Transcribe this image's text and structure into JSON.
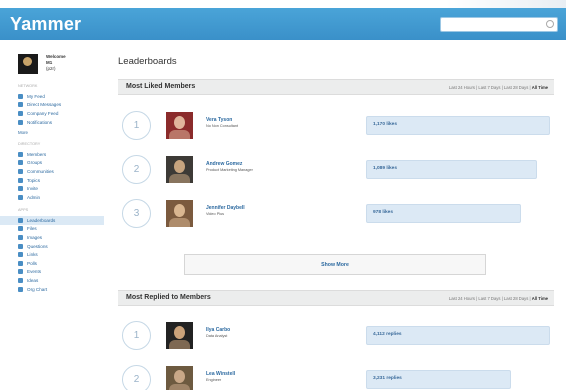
{
  "app": {
    "title": "Yammer",
    "search_placeholder": ""
  },
  "sidebar": {
    "welcome": [
      "Welcome",
      "M1",
      "(p2r)"
    ],
    "section1": "Network",
    "nav1": [
      {
        "label": "My Feed",
        "icon": "home-icon"
      },
      {
        "label": "Direct Messages",
        "icon": "mail-icon"
      },
      {
        "label": "Company Feed",
        "icon": "feed-icon"
      },
      {
        "label": "Notifications",
        "icon": "bell-icon"
      }
    ],
    "more": "More",
    "section2": "Directory",
    "nav2": [
      {
        "label": "Members",
        "icon": "person-icon"
      },
      {
        "label": "Groups",
        "icon": "group-icon"
      },
      {
        "label": "Communities",
        "icon": "globe-icon"
      },
      {
        "label": "Topics",
        "icon": "hashtag-icon"
      },
      {
        "label": "Invite",
        "icon": "envelope-icon"
      },
      {
        "label": "Admin",
        "icon": "wrench-icon"
      }
    ],
    "section3": "Apps",
    "nav3": [
      {
        "label": "Leaderboards",
        "icon": "trophy-icon",
        "active": true
      },
      {
        "label": "Files",
        "icon": "file-icon"
      },
      {
        "label": "Images",
        "icon": "image-icon"
      },
      {
        "label": "Questions",
        "icon": "question-icon"
      },
      {
        "label": "Links",
        "icon": "link-icon"
      },
      {
        "label": "Polls",
        "icon": "poll-icon"
      },
      {
        "label": "Events",
        "icon": "calendar-icon"
      },
      {
        "label": "Ideas",
        "icon": "lightbulb-icon"
      },
      {
        "label": "Org Chart",
        "icon": "orgchart-icon"
      }
    ]
  },
  "main": {
    "page_title": "Leaderboards",
    "liked": {
      "title": "Most Liked Members",
      "filters": [
        "Last 24 Hours",
        "Last 7 Days",
        "Last 28 Days",
        "All Time"
      ],
      "rows": [
        {
          "rank": "1",
          "name": "Vera Tyson",
          "title": "No Non Consultant",
          "value": "1,170 likes",
          "bar_fraction": 1.0
        },
        {
          "rank": "2",
          "name": "Andrew Gomez",
          "title": "Product Marketing Manager",
          "value": "1,089 likes",
          "bar_fraction": 0.93
        },
        {
          "rank": "3",
          "name": "Jennifer Daybell",
          "title": "Video Plus",
          "value": "978 likes",
          "bar_fraction": 0.84
        }
      ]
    },
    "show_more": "Show More",
    "replied": {
      "title": "Most Replied to Members",
      "filters": [
        "Last 24 Hours",
        "Last 7 Days",
        "Last 28 Days",
        "All Time"
      ],
      "rows": [
        {
          "rank": "1",
          "name": "Ilya Carbo",
          "title": "Data Analyst",
          "value": "4,112 replies",
          "bar_fraction": 1.0
        },
        {
          "rank": "2",
          "name": "Lea Winstell",
          "title": "Engineer",
          "value": "3,231 replies",
          "bar_fraction": 0.79
        }
      ]
    }
  }
}
